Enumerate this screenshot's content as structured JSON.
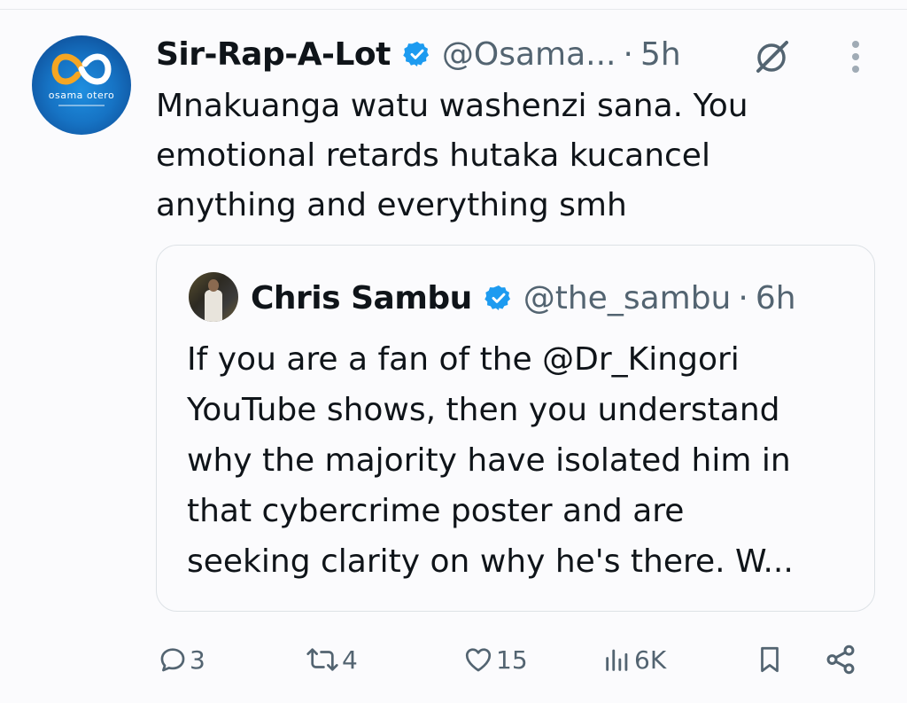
{
  "tweet": {
    "avatar": {
      "brand_text": "osama otero",
      "colors": {
        "ring_orange": "#f5a623",
        "ring_blue": "#ffffff",
        "bg": "#1673c4"
      }
    },
    "author_name": "Sir-Rap-A-Lot",
    "verified_icon": "verified-badge-icon",
    "handle": "@Osama...",
    "separator": "·",
    "time": "5h",
    "grok_icon": "grok-icon",
    "more_icon": "more-vertical-icon",
    "text_lines": [
      "Mnakuanga watu washenzi sana. You",
      "emotional retards hutaka kucancel",
      "anything and everything smh"
    ]
  },
  "quote": {
    "author_name": "Chris Sambu",
    "handle": "@the_sambu",
    "separator": "·",
    "time": "6h",
    "text_lines": [
      "If you are a fan of the @Dr_Kingori",
      "YouTube shows, then you understand",
      "why the majority have isolated him in",
      "that cybercrime poster and are",
      "seeking clarity on why he's there. W..."
    ]
  },
  "actions": {
    "reply": {
      "icon": "reply-icon",
      "count": "3"
    },
    "retweet": {
      "icon": "retweet-icon",
      "count": "4"
    },
    "like": {
      "icon": "heart-icon",
      "count": "15"
    },
    "views": {
      "icon": "views-icon",
      "count": "6K"
    },
    "bookmark": {
      "icon": "bookmark-icon"
    },
    "share": {
      "icon": "share-icon"
    }
  },
  "colors": {
    "verified_blue": "#1d9bf0",
    "text_primary": "#0f1419",
    "text_secondary": "#536471",
    "border": "#dde2e6"
  }
}
